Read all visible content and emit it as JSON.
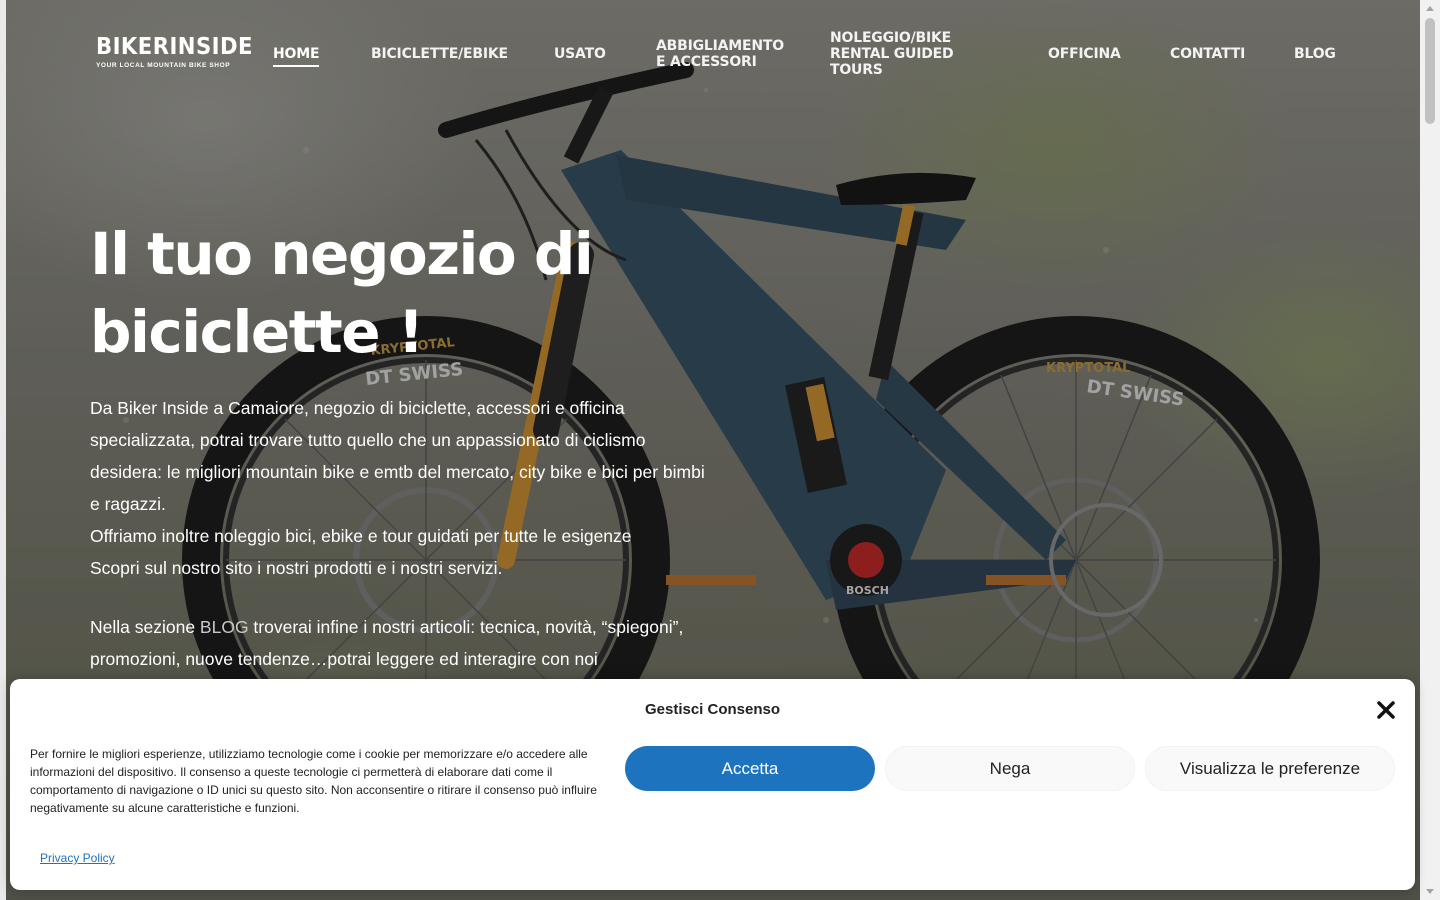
{
  "logo": {
    "main": "BIKERINSIDE",
    "tagline": "YOUR LOCAL MOUNTAIN BIKE SHOP"
  },
  "nav": [
    {
      "label": "HOME",
      "active": true
    },
    {
      "label": "BICICLETTE/EBIKE"
    },
    {
      "label": "USATO"
    },
    {
      "label": "ABBIGLIAMENTO E ACCESSORI"
    },
    {
      "label": "NOLEGGIO/BIKE RENTAL GUIDED TOURS"
    },
    {
      "label": "OFFICINA"
    },
    {
      "label": "CONTATTI"
    },
    {
      "label": "BLOG"
    }
  ],
  "hero": {
    "title": "Il tuo negozio di biciclette !",
    "paragraph1": "Da Biker Inside a Camaiore, negozio di biciclette, accessori e officina specializzata, potrai trovare tutto quello che un appassionato di ciclismo desidera: le migliori mountain bike e emtb del mercato, city bike e bici per bimbi e ragazzi.",
    "paragraph2": "Offriamo inoltre noleggio bici, ebike e tour guidati per tutte le esigenze",
    "paragraph3": "Scopri sul nostro sito i nostri prodotti e i nostri servizi.",
    "paragraph4_before": "Nella sezione ",
    "paragraph4_link": "BLOG",
    "paragraph4_after": " troverai infine i nostri articoli: tecnica, novità, “spiegoni”, promozioni, nuove tendenze…potrai leggere ed interagire con noi"
  },
  "bike_labels": {
    "tire_brand": "KRYPTOTAL",
    "rim_brand": "DT SWISS",
    "motor_brand": "BOSCH"
  },
  "consent": {
    "title": "Gestisci Consenso",
    "text": "Per fornire le migliori esperienze, utilizziamo tecnologie come i cookie per memorizzare e/o accedere alle informazioni del dispositivo. Il consenso a queste tecnologie ci permetterà di elaborare dati come il comportamento di navigazione o ID unici su questo sito. Non acconsentire o ritirare il consenso può influire negativamente su alcune caratteristiche e funzioni.",
    "accept": "Accetta",
    "deny": "Nega",
    "preferences": "Visualizza le preferenze",
    "privacy": "Privacy Policy"
  },
  "colors": {
    "accent": "#1e73be",
    "overlay_text": "#ffffff"
  }
}
